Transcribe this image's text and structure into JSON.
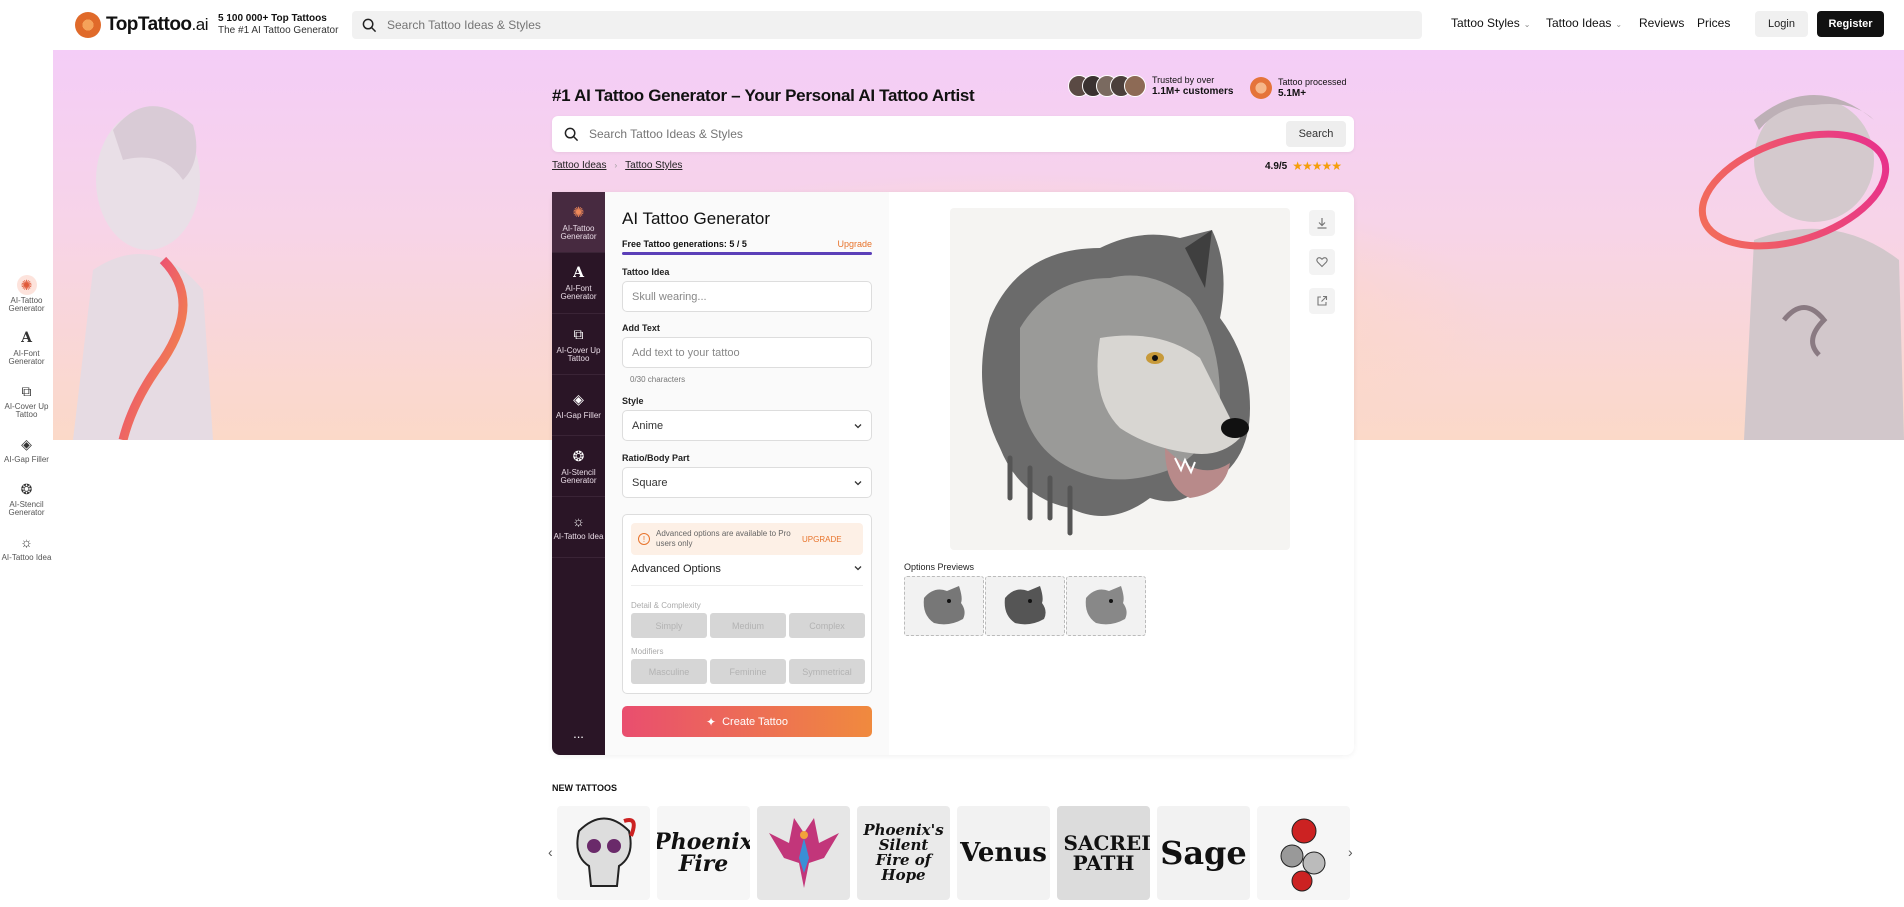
{
  "header": {
    "logo_main": "TopTattoo",
    "logo_suffix": ".ai",
    "tagline_1": "5 100 000+ Top Tattoos",
    "tagline_2": "The #1 AI Tattoo Generator",
    "search_placeholder": "Search Tattoo Ideas & Styles",
    "nav": {
      "styles": "Tattoo Styles",
      "ideas": "Tattoo Ideas",
      "reviews": "Reviews",
      "prices": "Prices"
    },
    "login": "Login",
    "register": "Register"
  },
  "hero": {
    "title": "#1 AI Tattoo Generator – Your Personal AI Tattoo Artist",
    "trusted_line1": "Trusted by over",
    "trusted_line2": "1.1M+ customers",
    "processed_line1": "Tattoo processed",
    "processed_line2": "5.1M+",
    "search_placeholder": "Search Tattoo Ideas & Styles",
    "search_button": "Search",
    "breadcrumb": [
      "Tattoo Ideas",
      "Tattoo Styles"
    ],
    "rating": "4.9/5",
    "stars": "★★★★★"
  },
  "left_rail": [
    {
      "label": "AI-Tattoo Generator",
      "icon": "tattoo-machine-icon"
    },
    {
      "label": "AI-Font Generator",
      "icon": "font-icon"
    },
    {
      "label": "AI-Cover Up Tattoo",
      "icon": "cover-up-icon"
    },
    {
      "label": "AI-Gap Filler",
      "icon": "paint-bucket-icon"
    },
    {
      "label": "AI-Stencil Generator",
      "icon": "stencil-icon"
    },
    {
      "label": "AI-Tattoo Idea",
      "icon": "lightbulb-icon"
    }
  ],
  "panel": {
    "sidebar": [
      {
        "label": "AI-Tattoo Generator",
        "icon": "tattoo-machine-icon"
      },
      {
        "label": "AI-Font Generator",
        "icon": "font-icon"
      },
      {
        "label": "AI-Cover Up Tattoo",
        "icon": "cover-up-icon"
      },
      {
        "label": "AI-Gap Filler",
        "icon": "paint-bucket-icon"
      },
      {
        "label": "AI-Stencil Generator",
        "icon": "stencil-icon"
      },
      {
        "label": "AI-Tattoo Idea",
        "icon": "lightbulb-icon"
      }
    ],
    "more": "...",
    "title": "AI Tattoo Generator",
    "free_generations": "Free Tattoo generations: 5 / 5",
    "upgrade": "Upgrade",
    "generations_progress": 1.0,
    "tattoo_idea_label": "Tattoo Idea",
    "tattoo_idea_placeholder": "Skull wearing...",
    "add_text_label": "Add Text",
    "add_text_placeholder": "Add text to your tattoo",
    "char_count": "0/30 characters",
    "style_label": "Style",
    "style_value": "Anime",
    "ratio_label": "Ratio/Body Part",
    "ratio_value": "Square",
    "pro_note": "Advanced options are available to Pro users only",
    "pro_upgrade": "UPGRADE",
    "advanced_options": "Advanced Options",
    "detail_label": "Detail & Complexity",
    "detail_options": [
      "Simply",
      "Medium",
      "Complex"
    ],
    "modifiers_label": "Modifiers",
    "modifier_options": [
      "Masculine",
      "Feminine",
      "Symmetrical"
    ],
    "create_button": "Create Tattoo",
    "options_previews": "Options Previews"
  },
  "new_tattoos": {
    "heading": "NEW TATTOOS",
    "items": [
      "",
      "Phoenix Fire",
      "",
      "Phoenix's Silent Fire of Hope",
      "Venus",
      "SACRED PATH",
      "Sage",
      ""
    ]
  },
  "colors": {
    "accent": "#e8742c",
    "sidebar": "#2a1526",
    "progress": "#5b3fb8"
  }
}
